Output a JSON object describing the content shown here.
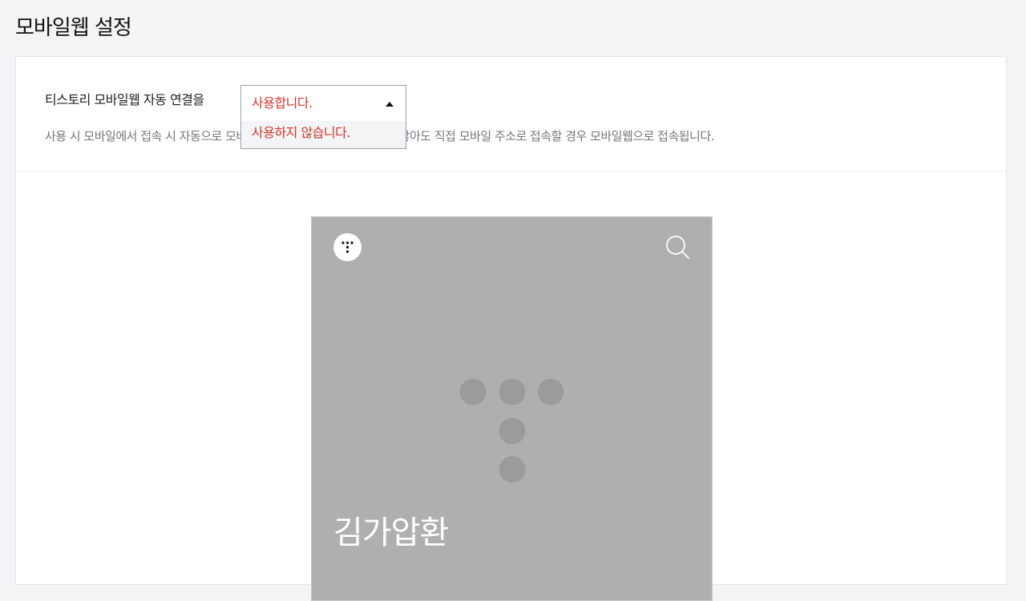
{
  "page": {
    "title": "모바일웹 설정"
  },
  "setting": {
    "label": "티스토리 모바일웹 자동 연결을",
    "dropdown": {
      "selected": "사용합니다.",
      "options": [
        "사용하지 않습니다."
      ]
    },
    "description": "사용 시 모바일에서 접속 시 자동으로 모바일웹으로 연결됩니다. 사용하지 않아도 직접 모바일 주소로 접속할 경우 모바일웹으로 접속됩니다."
  },
  "preview": {
    "blog_name": "김가압환",
    "menu_icon": "tistory-dots-icon",
    "search_icon": "search-icon"
  },
  "colors": {
    "accent": "#d0362b",
    "preview_bg": "#afafaf",
    "logo_dots": "#9b9b9b"
  }
}
